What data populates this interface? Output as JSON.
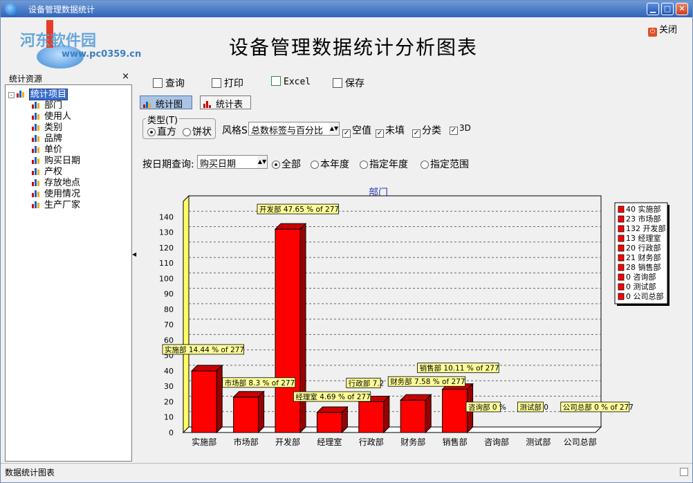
{
  "window": {
    "title": "设备管理数据统计",
    "close_label": "关闭"
  },
  "watermark": {
    "site": "河东软件园",
    "url": "www.pc0359.cn"
  },
  "main_title": "设备管理数据统计分析图表",
  "sidebar": {
    "header": "统计资源",
    "close_glyph": "×",
    "root": "统计项目",
    "items": [
      "部门",
      "使用人",
      "类别",
      "品牌",
      "单价",
      "购买日期",
      "产权",
      "存放地点",
      "使用情况",
      "生产厂家"
    ]
  },
  "toolbar": {
    "query": "查询",
    "print": "打印",
    "excel": "Excel",
    "save": "保存"
  },
  "tabs": {
    "chart": "统计图",
    "table": "统计表"
  },
  "controls": {
    "type_label": "类型(T)",
    "type_bar": "直方",
    "type_pie": "饼状",
    "style_label": "风格S",
    "style_value": "总数标签与百分比",
    "chk_empty": "空值",
    "chk_unfilled": "未填",
    "chk_category": "分类",
    "chk_3d": "3D",
    "date_label": "按日期查询:",
    "date_field": "购买日期",
    "r_all": "全部",
    "r_year": "本年度",
    "r_specified_year": "指定年度",
    "r_range": "指定范围"
  },
  "chart_data": {
    "type": "bar",
    "title": "部门",
    "categories": [
      "实施部",
      "市场部",
      "开发部",
      "经理室",
      "行政部",
      "财务部",
      "销售部",
      "咨询部",
      "测试部",
      "公司总部"
    ],
    "values": [
      40,
      23,
      132,
      13,
      20,
      21,
      28,
      0,
      0,
      0
    ],
    "data_labels": [
      "实施部 14.44 % of 277",
      "市场部 8.3 % of 277",
      "开发部 47.65 % of 277",
      "经理室 4.69 % of 277",
      "行政部 7.2",
      "财务部 7.58 % of 277",
      "销售部 10.11 % of 277",
      "咨询部 0 %",
      "测试部 0",
      "公司总部 0 % of 277"
    ],
    "legend": [
      "40 实施部",
      "23 市场部",
      "132 开发部",
      "13 经理室",
      "20 行政部",
      "21 财务部",
      "28 销售部",
      "0 咨询部",
      "0 测试部",
      "0 公司总部"
    ],
    "yticks": [
      0,
      10,
      20,
      30,
      40,
      50,
      60,
      70,
      80,
      90,
      100,
      110,
      120,
      130,
      140
    ],
    "ylim": [
      0,
      150
    ],
    "bar_color": "#ff0000",
    "grid": true,
    "legend_position": "right"
  },
  "status": {
    "text": "数据统计图表"
  }
}
